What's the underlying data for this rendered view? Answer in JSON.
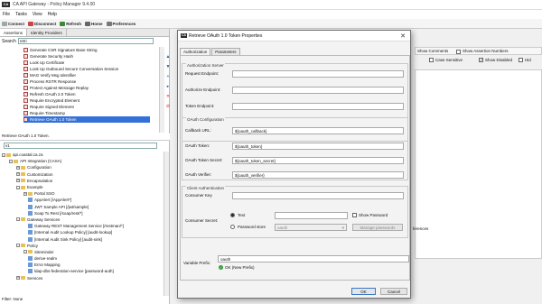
{
  "window": {
    "title": "CA API Gateway - Policy Manager 9.4.00",
    "logo": "CA"
  },
  "menu": [
    "File",
    "Tasks",
    "View",
    "Help"
  ],
  "toolbar": [
    {
      "label": "Connect",
      "icon": "connect-icon",
      "color": "#9aa"
    },
    {
      "label": "Disconnect",
      "icon": "disconnect-icon",
      "color": "#c44"
    },
    {
      "label": "Refresh",
      "icon": "refresh-icon",
      "color": "#3a8a3a"
    },
    {
      "label": "Home",
      "icon": "home-icon",
      "color": "#666"
    },
    {
      "label": "Preferences",
      "icon": "preferences-icon",
      "color": "#777"
    }
  ],
  "left": {
    "tabs": [
      "Assertions",
      "Identity Providers"
    ],
    "search_label": "Search",
    "search_value": "retri",
    "assertions": [
      "Generate CSR Signature Base String",
      "Generate Security Hash",
      "Look Up Certificate",
      "Look Up Outbound Secure Conversation Session",
      "MAG Verify Msg Identifier",
      "Process RSTR Response",
      "Protect Against Message Replay",
      "Refresh OAuth 2.0 Token",
      "Require Encrypted Element",
      "Require Signed Element",
      "Require Timestamp",
      "Retrieve OAuth 1.0 Token"
    ],
    "assertion_status": "Retrieve OAuth 1.0 Token.",
    "tree_search_value": "v1",
    "tree": [
      {
        "d": 0,
        "exp": "-",
        "icon": "server",
        "label": "api.coastal.ca.za"
      },
      {
        "d": 1,
        "exp": "-",
        "icon": "folder",
        "label": "API Integration (CASA)"
      },
      {
        "d": 2,
        "exp": "+",
        "icon": "folder",
        "label": "Configuration"
      },
      {
        "d": 2,
        "exp": "+",
        "icon": "folder",
        "label": "Customization"
      },
      {
        "d": 2,
        "exp": "+",
        "icon": "folder",
        "label": "Encapsulation"
      },
      {
        "d": 2,
        "exp": "-",
        "icon": "folder",
        "label": "Example"
      },
      {
        "d": 3,
        "exp": "+",
        "icon": "folder",
        "label": "Portal SSO"
      },
      {
        "d": 3,
        "exp": "",
        "icon": "policy",
        "label": "AppAlert [/AppAlert*]"
      },
      {
        "d": 3,
        "exp": "",
        "icon": "policy",
        "label": "JWT Sample API [/jwt/sample]"
      },
      {
        "d": 3,
        "exp": "",
        "icon": "policy",
        "label": "Soap To Rest [/soap/rest/*]"
      },
      {
        "d": 2,
        "exp": "-",
        "icon": "folder",
        "label": "Gateway Services"
      },
      {
        "d": 3,
        "exp": "",
        "icon": "policy",
        "label": "Gateway REST Management Service [/restman/*]"
      },
      {
        "d": 3,
        "exp": "",
        "icon": "policy",
        "label": "[Internal Audit Lookup Policy] [audit-lookup]"
      },
      {
        "d": 3,
        "exp": "",
        "icon": "policy",
        "label": "[Internal Audit Sink Policy] [audit-sink]"
      },
      {
        "d": 2,
        "exp": "-",
        "icon": "folder",
        "label": "Policy"
      },
      {
        "d": 3,
        "exp": "-",
        "icon": "folder",
        "label": "Siteminder"
      },
      {
        "d": 3,
        "exp": "",
        "icon": "policy",
        "label": "derive-realm"
      },
      {
        "d": 3,
        "exp": "",
        "icon": "policy",
        "label": "Error Mapping"
      },
      {
        "d": 3,
        "exp": "",
        "icon": "policy",
        "label": "ldap-dbs-federation-service [password-auth]"
      },
      {
        "d": 2,
        "exp": "+",
        "icon": "folder",
        "label": "Services"
      }
    ],
    "bottom_status": "Filter: None"
  },
  "right": {
    "show_comments": "Show Comments",
    "show_assertion_numbers": "Show Assertion Numbers",
    "case_sensitive": "Case Sensitive",
    "show_disabled": "Show Disabled",
    "hide_fragment": "Hid",
    "partial_text": "ferences"
  },
  "dialog": {
    "logo": "CA",
    "title": "Retrieve OAuth 1.0 Token Properties",
    "tabs": [
      "Authorization",
      "Parameters"
    ],
    "auth_server": {
      "title": "Authorization Server",
      "request_endpoint": "Request Endpoint:",
      "authorize_endpoint": "Authorize Endpoint:",
      "token_endpoint": "Token Endpoint:"
    },
    "oauth_config": {
      "title": "OAuth Configuration",
      "callback_label": "Callback URL:",
      "callback_value": "${oauth_callback}",
      "token_label": "OAuth Token:",
      "token_value": "${oauth_token}",
      "token_secret_label": "OAuth Token Secret:",
      "token_secret_value": "${oauth_token_secret}",
      "verifier_label": "OAuth Verifier:",
      "verifier_value": "${oauth_verifier}"
    },
    "client_auth": {
      "title": "Client Authentication",
      "consumer_key_label": "Consumer Key",
      "consumer_secret_label": "Consumer Secret:",
      "text_option": "Text",
      "password_store_option": "Password store",
      "password_store_value": "oauth",
      "show_password": "Show Password",
      "manage_passwords": "Manage passwords"
    },
    "variable_prefix_label": "Variable Prefix:",
    "variable_prefix_value": "oauth",
    "prefix_status": "OK (New Prefix)",
    "ok": "OK",
    "cancel": "Cancel"
  }
}
